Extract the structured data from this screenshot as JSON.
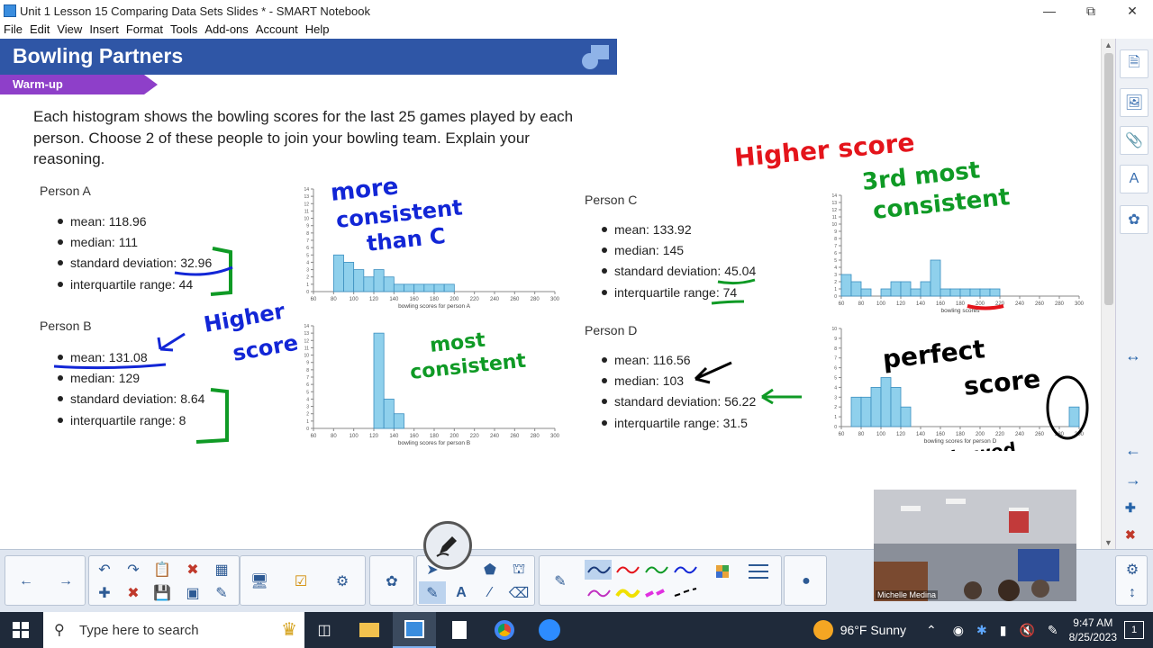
{
  "window": {
    "title": "Unit 1 Lesson 15 Comparing Data Sets Slides * - SMART Notebook"
  },
  "menu": [
    "File",
    "Edit",
    "View",
    "Insert",
    "Format",
    "Tools",
    "Add-ons",
    "Account",
    "Help"
  ],
  "slide": {
    "title": "Bowling Partners",
    "tag": "Warm-up",
    "prompt": "Each histogram shows the bowling scores for the last 25 games played by each person. Choose 2 of these people to join your bowling team. Explain your reasoning.",
    "people": [
      {
        "name": "Person A",
        "stats": [
          "mean: 118.96",
          "median: 111",
          "standard deviation: 32.96",
          "interquartile range: 44"
        ],
        "xlabel": "bowling scores for person A"
      },
      {
        "name": "Person B",
        "stats": [
          "mean: 131.08",
          "median: 129",
          "standard deviation: 8.64",
          "interquartile range: 8"
        ],
        "xlabel": "bowling scores for person B"
      },
      {
        "name": "Person C",
        "stats": [
          "mean: 133.92",
          "median: 145",
          "standard deviation: 45.04",
          "interquartile range: 74"
        ],
        "xlabel": "bowling scores"
      },
      {
        "name": "Person D",
        "stats": [
          "mean: 116.56",
          "median: 103",
          "standard deviation: 56.22",
          "interquartile range: 31.5"
        ],
        "xlabel": "bowling scores for person D"
      }
    ],
    "annotations": {
      "a": [
        "more",
        "consistent",
        "than C"
      ],
      "b_higher": [
        "Higher",
        "score"
      ],
      "b_consistent": [
        "most",
        "consistent"
      ],
      "c": [
        "Higher score",
        "3rd most",
        "consistent"
      ],
      "d": [
        "perfect",
        "score",
        "skewed"
      ]
    },
    "colors": {
      "header": "#2f56a6",
      "tag": "#8e3fc9",
      "bar": "#8fd0ec",
      "ink_blue": "#1226d6",
      "ink_green": "#0f9a25",
      "ink_red": "#e4141b",
      "ink_black": "#000000"
    }
  },
  "chart_data": [
    {
      "type": "bar",
      "title": "",
      "xlabel": "bowling scores for person A",
      "ylabel": "",
      "xticks": [
        "60",
        "80",
        "100",
        "120",
        "140",
        "160",
        "180",
        "200",
        "220",
        "240",
        "260",
        "280",
        "300"
      ],
      "yticks": [
        "0",
        "1",
        "2",
        "3",
        "4",
        "5",
        "6",
        "7",
        "8",
        "9",
        "10",
        "11",
        "12",
        "13",
        "14"
      ],
      "bins": [
        [
          80,
          90
        ],
        [
          90,
          100
        ],
        [
          100,
          110
        ],
        [
          110,
          120
        ],
        [
          120,
          130
        ],
        [
          130,
          140
        ],
        [
          140,
          150
        ],
        [
          150,
          160
        ],
        [
          160,
          170
        ],
        [
          170,
          180
        ],
        [
          180,
          190
        ],
        [
          190,
          200
        ]
      ],
      "values": [
        5,
        4,
        3,
        2,
        3,
        2,
        1,
        1,
        1,
        1,
        1,
        1
      ],
      "ylim": [
        0,
        14
      ]
    },
    {
      "type": "bar",
      "title": "",
      "xlabel": "bowling scores for person B",
      "ylabel": "",
      "xticks": [
        "60",
        "80",
        "100",
        "120",
        "140",
        "160",
        "180",
        "200",
        "220",
        "240",
        "260",
        "280",
        "300"
      ],
      "yticks": [
        "0",
        "1",
        "2",
        "3",
        "4",
        "5",
        "6",
        "7",
        "8",
        "9",
        "10",
        "11",
        "12",
        "13",
        "14"
      ],
      "bins": [
        [
          120,
          130
        ],
        [
          130,
          140
        ],
        [
          140,
          150
        ]
      ],
      "values": [
        13,
        4,
        2
      ],
      "ylim": [
        0,
        14
      ]
    },
    {
      "type": "bar",
      "title": "",
      "xlabel": "bowling scores",
      "ylabel": "",
      "xticks": [
        "60",
        "80",
        "100",
        "120",
        "140",
        "160",
        "180",
        "200",
        "220",
        "240",
        "260",
        "280",
        "300"
      ],
      "yticks": [
        "0",
        "1",
        "2",
        "3",
        "4",
        "5",
        "6",
        "7",
        "8",
        "9",
        "10",
        "11",
        "12",
        "13",
        "14"
      ],
      "bins": [
        [
          60,
          70
        ],
        [
          70,
          80
        ],
        [
          80,
          90
        ],
        [
          90,
          100
        ],
        [
          100,
          110
        ],
        [
          110,
          120
        ],
        [
          120,
          130
        ],
        [
          130,
          140
        ],
        [
          140,
          150
        ],
        [
          150,
          160
        ],
        [
          160,
          170
        ],
        [
          170,
          180
        ],
        [
          180,
          190
        ],
        [
          190,
          200
        ],
        [
          200,
          210
        ],
        [
          210,
          220
        ]
      ],
      "values": [
        3,
        2,
        1,
        0,
        1,
        2,
        2,
        1,
        2,
        5,
        1,
        1,
        1,
        1,
        1,
        1
      ],
      "ylim": [
        0,
        14
      ]
    },
    {
      "type": "bar",
      "title": "",
      "xlabel": "bowling scores for person D",
      "ylabel": "",
      "xticks": [
        "60",
        "80",
        "100",
        "120",
        "140",
        "160",
        "180",
        "200",
        "220",
        "240",
        "260",
        "280",
        "300"
      ],
      "yticks": [
        "0",
        "1",
        "2",
        "3",
        "4",
        "5",
        "6",
        "7",
        "8",
        "9",
        "10"
      ],
      "bins": [
        [
          70,
          80
        ],
        [
          80,
          90
        ],
        [
          90,
          100
        ],
        [
          100,
          110
        ],
        [
          110,
          120
        ],
        [
          120,
          130
        ],
        [
          290,
          300
        ]
      ],
      "values": [
        3,
        3,
        4,
        5,
        4,
        2,
        2
      ],
      "ylim": [
        0,
        10
      ]
    }
  ],
  "webcam": {
    "name": "Michelle Medina"
  },
  "taskbar": {
    "search_placeholder": "Type here to search",
    "weather": "96°F  Sunny",
    "time": "9:47 AM",
    "date": "8/25/2023",
    "notification_count": "1"
  }
}
